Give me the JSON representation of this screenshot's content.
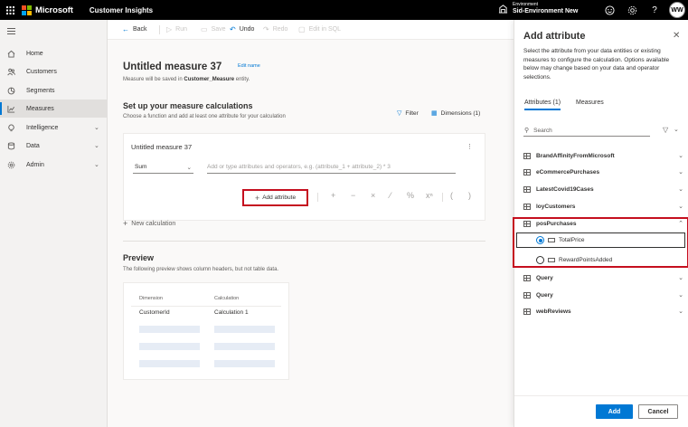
{
  "topbar": {
    "brand": "Microsoft",
    "app_name": "Customer Insights",
    "env_label": "Environment",
    "env_name": "Sid-Environment New",
    "avatar_initials": "WW",
    "bg_color": "#000000"
  },
  "nav": {
    "items": [
      {
        "label": "Home",
        "icon": "home-icon"
      },
      {
        "label": "Customers",
        "icon": "people-icon"
      },
      {
        "label": "Segments",
        "icon": "segments-icon"
      },
      {
        "label": "Measures",
        "icon": "chart-icon",
        "active": true
      },
      {
        "label": "Intelligence",
        "icon": "lightbulb-icon"
      },
      {
        "label": "Data",
        "icon": "database-icon"
      },
      {
        "label": "Admin",
        "icon": "gear-icon"
      }
    ]
  },
  "cmdbar": {
    "back": "Back",
    "run": "Run",
    "save": "Save",
    "undo": "Undo",
    "redo": "Redo",
    "edit_sql": "Edit in SQL"
  },
  "main": {
    "title": "Untitled measure 37",
    "edit_name": "Edit name",
    "subtitle_prefix": "Measure will be saved in",
    "subtitle_entity": "Customer_Measure",
    "subtitle_suffix": "entity.",
    "section_title": "Set up your measure calculations",
    "section_sub": "Choose a function and add at least one attribute for your calculation",
    "filter_label": "Filter",
    "dimensions_label": "Dimensions (1)"
  },
  "calc_card": {
    "title": "Untitled measure 37",
    "function": "Sum",
    "formula_placeholder": "Add or type attributes and operators, e.g. (attribute_1 + attribute_2) * 3",
    "add_attribute": "Add attribute",
    "operators": [
      "+",
      "−",
      "×",
      "⁄",
      "%",
      "xⁿ",
      "(",
      ")"
    ]
  },
  "new_calculation": "New calculation",
  "preview": {
    "title": "Preview",
    "subtitle": "The following preview shows column headers, but not table data.",
    "col1_header": "Dimension",
    "col1_name": "CustomerId",
    "col2_header": "Calculation",
    "col2_name": "Calculation 1"
  },
  "panel": {
    "title": "Add attribute",
    "description": "Select the attribute from your data entities or existing measures to configure the calculation. Options available below may change based on your data and operator selections.",
    "tab_attributes": "Attributes (1)",
    "tab_measures": "Measures",
    "search_placeholder": "Search",
    "entities": [
      "BrandAffinityFromMicrosoft",
      "eCommercePurchases",
      "LatestCovid19Cases",
      "loyCustomers",
      "posPurchases",
      "Query",
      "Query",
      "webReviews"
    ],
    "pos_attributes": [
      {
        "label": "TotalPrice",
        "selected": true
      },
      {
        "label": "RewardPointsAdded",
        "selected": false
      }
    ],
    "add_button": "Add",
    "cancel_button": "Cancel"
  },
  "colors": {
    "accent": "#0078d4",
    "highlight": "#c50f1f"
  }
}
